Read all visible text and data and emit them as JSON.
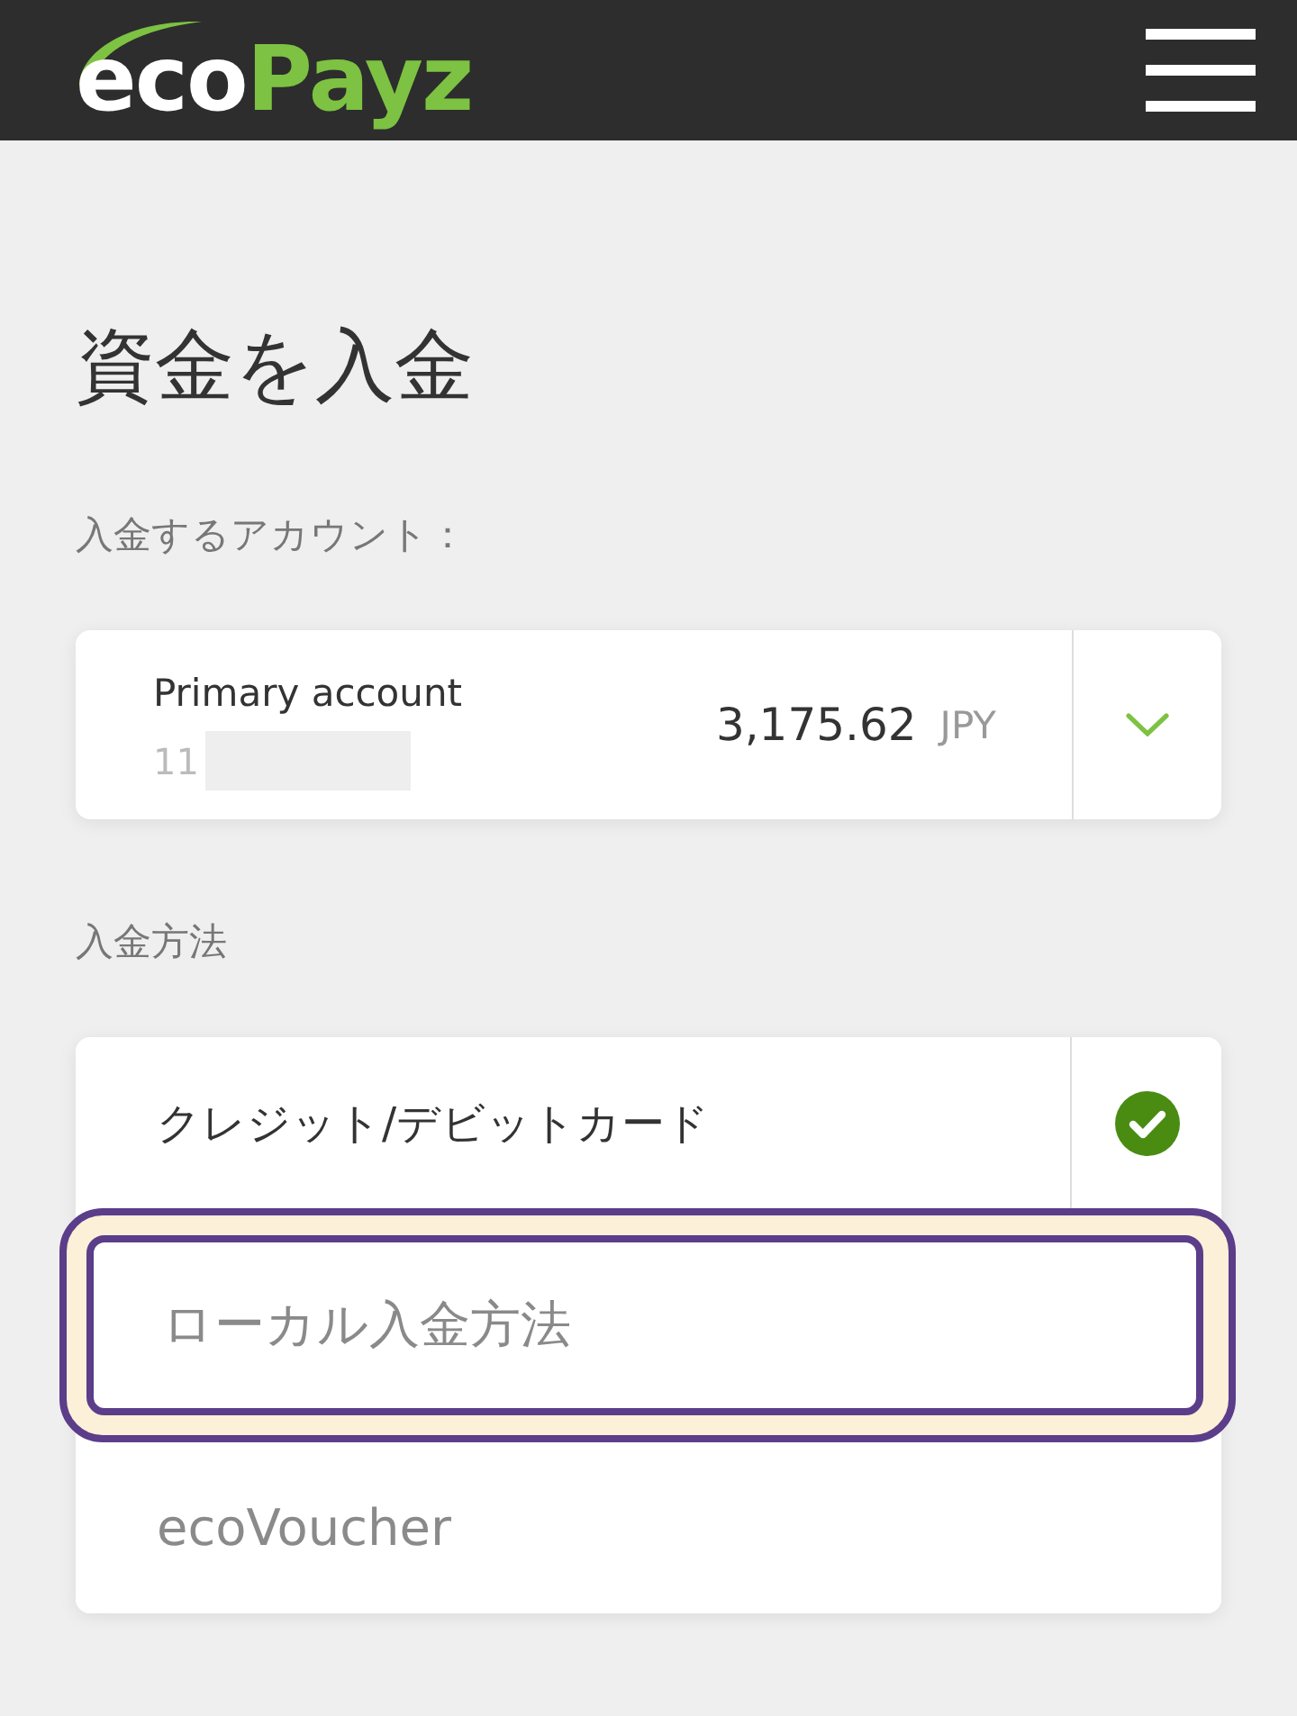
{
  "header": {
    "logo": {
      "text": "eco",
      "accent": "Payz"
    }
  },
  "title": "資金を入金",
  "account_section": {
    "label": "入金するアカウント：",
    "account": {
      "name": "Primary account",
      "number": "11",
      "number_redacted": true,
      "balance": "3,175.62",
      "currency": "JPY"
    }
  },
  "method_section": {
    "label": "入金方法",
    "methods": [
      {
        "label": "クレジット/デビットカード",
        "selected": true,
        "highlighted": false
      },
      {
        "label": "ローカル入金方法",
        "selected": false,
        "highlighted": true
      },
      {
        "label": "ecoVoucher",
        "selected": false,
        "highlighted": false
      }
    ]
  }
}
